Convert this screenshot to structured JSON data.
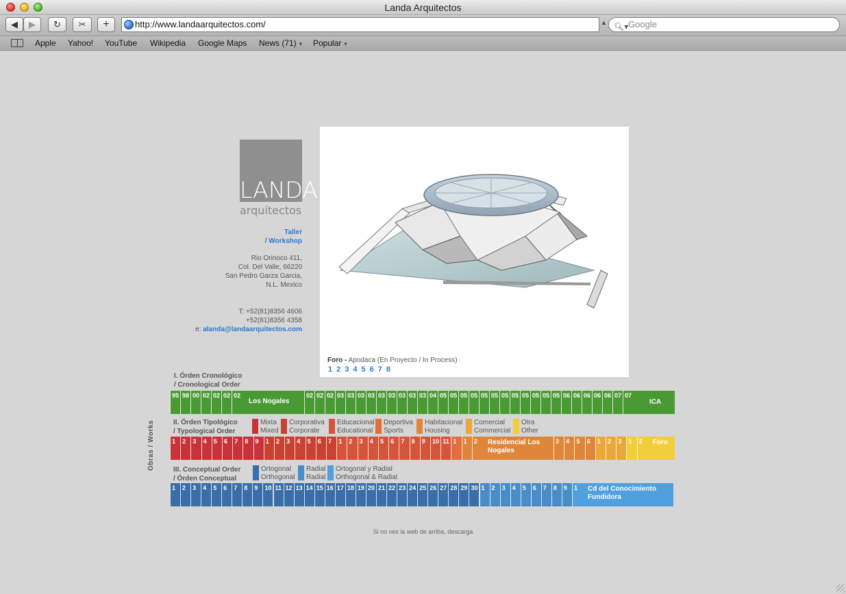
{
  "window": {
    "title": "Landa Arquitectos"
  },
  "toolbar": {
    "url": "http://www.landaarquitectos.com/",
    "search_placeholder": "Google"
  },
  "bookmarks": {
    "items": [
      "Apple",
      "Yahoo!",
      "YouTube",
      "Wikipedia",
      "Google Maps",
      "News (71)",
      "Popular"
    ]
  },
  "logo": {
    "word": "LANDA",
    "sub": "arquitectos"
  },
  "side": {
    "taller": "Taller",
    "workshop": "/ Workshop",
    "address": [
      "Rio Orinoco 411,",
      "Col. Del Valle,  66220",
      "San Pedro Garza Garcia,",
      "N.L. Mexico"
    ],
    "phone1": "T:  +52(81)8356 4606",
    "phone2": "+52(81)8356 4358",
    "email_prefix": "e:",
    "email": "alanda@landaarquitectos.com"
  },
  "project": {
    "name": "Foro -",
    "detail": " Apodaca (En Proyecto / In Process)",
    "pages": [
      "1",
      "2",
      "3",
      "4",
      "5",
      "6",
      "7",
      "8"
    ]
  },
  "sections": {
    "chrono": {
      "line1": "I. Órden Cronológico",
      "line2": "/ Cronological Order"
    },
    "typo": {
      "line1": "II. Órden Tipológico",
      "line2": "/ Typological  Order"
    },
    "concept": {
      "line1": "III. Conceptual Order",
      "line2": "/ Órden Conceptual"
    },
    "vertical": "Obras / Works"
  },
  "chrono_bar": {
    "color": "#4a9a34",
    "cells": [
      "95",
      "98",
      "00",
      "02",
      "02",
      "02",
      "02"
    ],
    "highlight": "Los Nogales",
    "cells2": [
      "02",
      "02",
      "02",
      "03",
      "03",
      "03",
      "03",
      "03",
      "03",
      "03",
      "03",
      "03",
      "04",
      "05",
      "05",
      "05",
      "05",
      "05",
      "05",
      "05",
      "05",
      "05",
      "05",
      "05",
      "05",
      "06",
      "06",
      "06",
      "06",
      "06",
      "07",
      "07"
    ],
    "end_label": "ICA"
  },
  "typo_legend": [
    {
      "es": "Mixta",
      "en": "Mixed",
      "color": "#c8333a"
    },
    {
      "es": "Corporativa",
      "en": "Corporate",
      "color": "#c84232"
    },
    {
      "es": "Educacional",
      "en": "Educational",
      "color": "#d4553a"
    },
    {
      "es": "Deportiva",
      "en": "Sports",
      "color": "#e06f3a"
    },
    {
      "es": "Habitacional",
      "en": "Housing",
      "color": "#e0863a"
    },
    {
      "es": "Comercial",
      "en": "Commercial",
      "color": "#eaa83a"
    },
    {
      "es": "Otra",
      "en": "Other",
      "color": "#f2cf3a"
    }
  ],
  "typo_bar": {
    "groups": [
      {
        "color": "#c8333a",
        "cells": [
          "1",
          "2",
          "3",
          "4",
          "5",
          "6",
          "7",
          "8",
          "9"
        ]
      },
      {
        "color": "#c84232",
        "cells": [
          "1",
          "2",
          "3",
          "4",
          "5",
          "6",
          "7"
        ]
      },
      {
        "color": "#d4553a",
        "cells": [
          "1",
          "2",
          "3",
          "4",
          "5",
          "6",
          "7",
          "8",
          "9",
          "10",
          "11"
        ]
      },
      {
        "color": "#e06f3a",
        "cells": [
          "1"
        ]
      },
      {
        "color": "#e0863a",
        "cells": [
          "1",
          "2"
        ],
        "label": "Residencial Los Nogales",
        "tail": [
          "3",
          "4",
          "5",
          "6"
        ]
      },
      {
        "color": "#eaa83a",
        "cells": [
          "1",
          "2",
          "3"
        ]
      },
      {
        "color": "#f2cf3a",
        "cells": [
          "1",
          "2"
        ],
        "label": "Foro"
      }
    ]
  },
  "concept_legend": [
    {
      "es": "Ortogonal",
      "en": "Orthogonal",
      "color": "#3a6ea8"
    },
    {
      "es": "Radial",
      "en": "Radial",
      "color": "#4a8cc8"
    },
    {
      "es": "Ortogonal y Radial",
      "en": "Orthogonal & Radial",
      "color": "#4fa0dc"
    }
  ],
  "concept_bar": {
    "groups": [
      {
        "color": "#3a6ea8",
        "cells": [
          "1",
          "2",
          "3",
          "4",
          "5",
          "6",
          "7",
          "8",
          "9",
          "10",
          "11",
          "12",
          "13",
          "14",
          "15",
          "16",
          "17",
          "18",
          "19",
          "20",
          "21",
          "22",
          "23",
          "24",
          "25",
          "26",
          "27",
          "28",
          "29",
          "30"
        ]
      },
      {
        "color": "#4a8cc8",
        "cells": [
          "1",
          "2",
          "3",
          "4",
          "5",
          "6",
          "7",
          "8",
          "9"
        ]
      },
      {
        "color": "#4fa0dc",
        "cells": [
          "1"
        ],
        "label": "Cd del Conocimiento Fundidora"
      }
    ]
  },
  "footer": "Si no ves la web de arriba, descarga"
}
